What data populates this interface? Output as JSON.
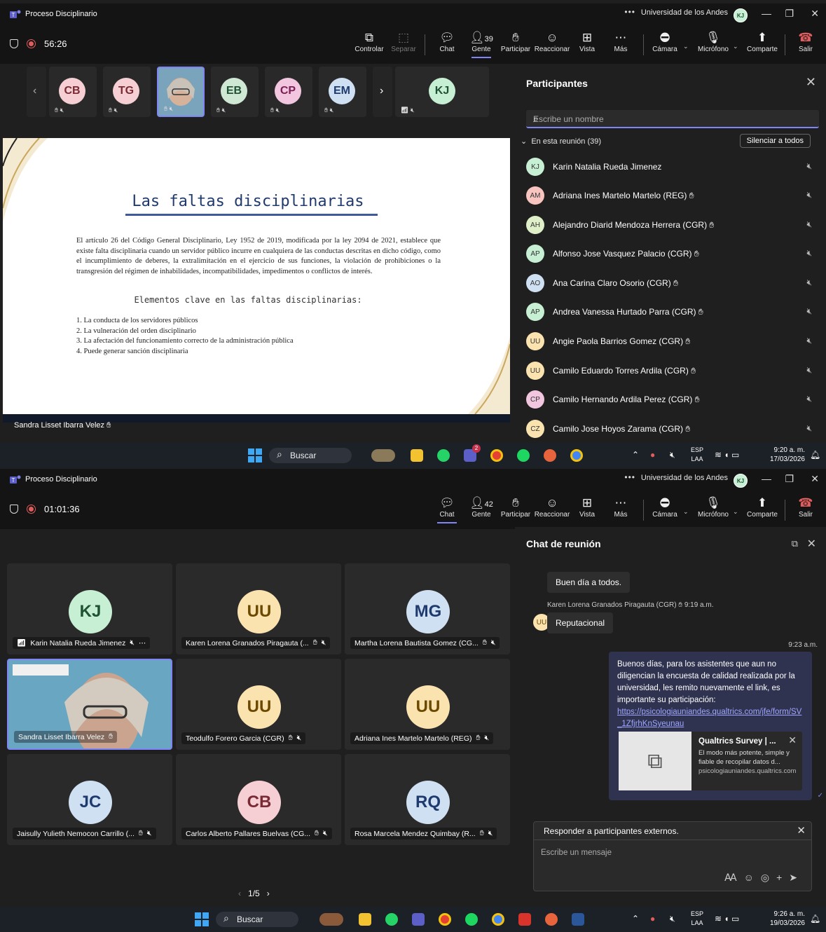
{
  "top": {
    "title": "Proceso Disciplinario",
    "org": "Universidad de los Andes",
    "org_avatar": "KJ",
    "timer": "56:26",
    "toolbar": {
      "controlar": "Controlar",
      "separar": "Separar",
      "chat": "Chat",
      "gente": "Gente",
      "gente_count": "39",
      "participar": "Participar",
      "reaccionar": "Reaccionar",
      "vista": "Vista",
      "mas": "Más",
      "camara": "Cámara",
      "microfono": "Micrófono",
      "comparte": "Comparte",
      "salir": "Salir"
    },
    "thumbs": [
      {
        "initials": "CB",
        "color": "#f5cfd3"
      },
      {
        "initials": "TG",
        "color": "#f5cfd3"
      },
      {
        "initials": "",
        "color": "#8fb3c6"
      },
      {
        "initials": "EB",
        "color": "#cfe8d4"
      },
      {
        "initials": "CP",
        "color": "#f3c6e0"
      },
      {
        "initials": "EM",
        "color": "#cfe0f3"
      }
    ],
    "kj_thumb": "KJ",
    "slide": {
      "title": "Las faltas disciplinarias",
      "body": "El artículo 26 del Código General Disciplinario, Ley 1952 de 2019, modificada por la ley 2094 de 2021, establece que existe falta disciplinaria cuando un servidor público incurre en cualquiera de las conductas descritas en dicho código, como el incumplimiento de deberes, la extralimitación en el ejercicio de sus funciones, la violación de prohibiciones o la transgresión del régimen de inhabilidades, incompatibilidades, impedimentos o conflictos de interés.",
      "subtitle": "Elementos clave en las faltas disciplinarias:",
      "items": [
        "1.   La conducta de los servidores públicos",
        "2.   La vulneración del orden disciplinario",
        "3.   La afectación del funcionamiento correcto de la administración pública",
        "4.   Puede generar sanción disciplinaria"
      ]
    },
    "presenter": "Sandra Lisset Ibarra Velez",
    "panel": {
      "title": "Participantes",
      "search_placeholder": "Escribe un nombre",
      "section": "En esta reunión (39)",
      "mute_all": "Silenciar a todos",
      "people": [
        {
          "initials": "KJ",
          "name": "Karin Natalia Rueda Jimenez",
          "color": "#c6efd3"
        },
        {
          "initials": "AM",
          "name": "Adriana Ines Martelo Martelo (REG)",
          "color": "#f7c4c0"
        },
        {
          "initials": "AH",
          "name": "Alejandro Diarid Mendoza Herrera (CGR)",
          "color": "#dff0c9"
        },
        {
          "initials": "AP",
          "name": "Alfonso Jose Vasquez Palacio (CGR)",
          "color": "#c6efd3"
        },
        {
          "initials": "AO",
          "name": "Ana Carina Claro Osorio (CGR)",
          "color": "#cfe0f3"
        },
        {
          "initials": "AP",
          "name": "Andrea Vanessa Hurtado Parra (CGR)",
          "color": "#c6efd3"
        },
        {
          "initials": "UU",
          "name": "Angie Paola Barrios Gomez (CGR)",
          "color": "#fbe3b0"
        },
        {
          "initials": "UU",
          "name": "Camilo Eduardo Torres Ardila (CGR)",
          "color": "#fbe3b0"
        },
        {
          "initials": "CP",
          "name": "Camilo Hernando Ardila Perez (CGR)",
          "color": "#f3c6e0"
        },
        {
          "initials": "CZ",
          "name": "Camilo Jose Hoyos Zarama (CGR)",
          "color": "#fbe3b0"
        }
      ]
    },
    "taskbar": {
      "search": "Buscar",
      "lang1": "ESP",
      "lang2": "LAA",
      "time": "9:20 a. m.",
      "date": "17/03/2026",
      "teams_badge": "2"
    }
  },
  "bottom": {
    "title": "Proceso Disciplinario",
    "org": "Universidad de los Andes",
    "org_avatar": "KJ",
    "timer": "01:01:36",
    "toolbar": {
      "chat": "Chat",
      "gente": "Gente",
      "gente_count": "42",
      "participar": "Participar",
      "reaccionar": "Reaccionar",
      "vista": "Vista",
      "mas": "Más",
      "camara": "Cámara",
      "microfono": "Micrófono",
      "comparte": "Comparte",
      "salir": "Salir"
    },
    "tiles": [
      {
        "initials": "KJ",
        "name": "Karin Natalia Rueda Jimenez",
        "color": "#c6efd3",
        "tcolor": "#1f5133"
      },
      {
        "initials": "UU",
        "name": "Karen Lorena Granados Piragauta (...",
        "color": "#fbe3b0",
        "tcolor": "#6b4a00"
      },
      {
        "initials": "MG",
        "name": "Martha Lorena Bautista Gomez (CG...",
        "color": "#cfe0f3",
        "tcolor": "#1f3b6e"
      },
      {
        "initials": "",
        "name": "Sandra Lisset Ibarra Velez",
        "color": "",
        "tcolor": ""
      },
      {
        "initials": "UU",
        "name": "Teodulfo Forero Garcia (CGR)",
        "color": "#fbe3b0",
        "tcolor": "#6b4a00"
      },
      {
        "initials": "UU",
        "name": "Adriana Ines Martelo Martelo (REG)",
        "color": "#fbe3b0",
        "tcolor": "#6b4a00"
      },
      {
        "initials": "JC",
        "name": "Jaisully Yulieth Nemocon Carrillo (...",
        "color": "#cfe0f3",
        "tcolor": "#1f3b6e"
      },
      {
        "initials": "CB",
        "name": "Carlos Alberto Pallares Buelvas (CG...",
        "color": "#f5cfd3",
        "tcolor": "#7a2a34"
      },
      {
        "initials": "RQ",
        "name": "Rosa Marcela Mendez Quimbay (R...",
        "color": "#cfe0f3",
        "tcolor": "#1f3b6e"
      }
    ],
    "pager": "1/5",
    "chat": {
      "title": "Chat de reunión",
      "msg1": "Buen día a todos.",
      "sender": "Karen Lorena Granados Piragauta (CGR)",
      "sender_time": "9:19 a.m.",
      "sender_initials": "UU",
      "msg2": "Reputacional",
      "out_time": "9:23 a.m.",
      "out_text": "Buenos días, para los asistentes que aun no diligencian la encuesta de calidad realizada por la universidad, les remito nuevamente el link, es importante su participación:",
      "out_link": "https://psicologiauniandes.qualtrics.com/jfe/form/SV_1ZfjrhKnSyeunau",
      "card_title": "Qualtrics Survey | ...",
      "card_desc": "El modo más potente, simple y fiable de recopilar datos d...",
      "card_domain": "psicologiauniandes.qualtrics.com",
      "banner": "Responder a participantes externos.",
      "placeholder": "Escribe un mensaje"
    },
    "taskbar": {
      "search": "Buscar",
      "lang1": "ESP",
      "lang2": "LAA",
      "time": "9:26 a. m.",
      "date": "19/03/2026"
    }
  },
  "colors": {
    "accent": "#7f85f5",
    "leave": "#e05d5d",
    "record": "#e05d5d"
  }
}
